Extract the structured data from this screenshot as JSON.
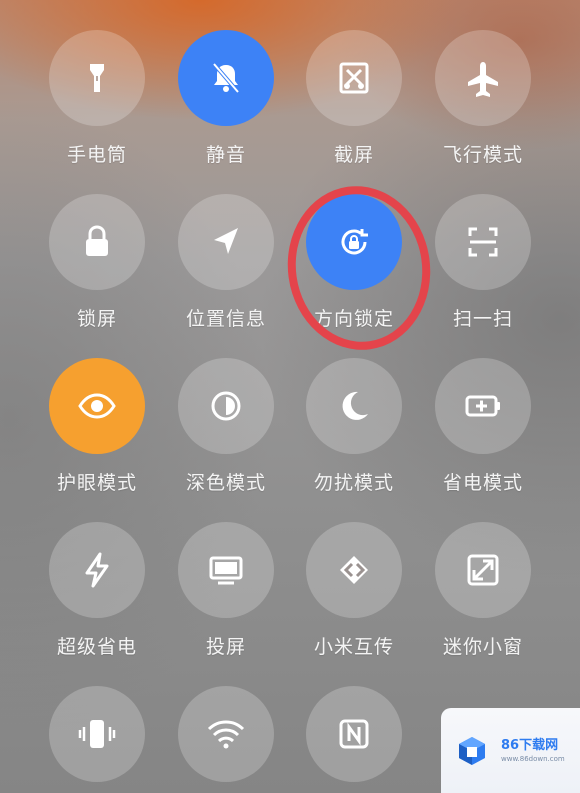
{
  "tiles": [
    {
      "id": "flashlight",
      "label": "手电筒",
      "icon": "flashlight-icon",
      "active": false
    },
    {
      "id": "mute",
      "label": "静音",
      "icon": "mute-bell-icon",
      "active": true,
      "active_color": "#3d82f6"
    },
    {
      "id": "screenshot",
      "label": "截屏",
      "icon": "screenshot-scissors-icon",
      "active": false
    },
    {
      "id": "airplane",
      "label": "飞行模式",
      "icon": "airplane-icon",
      "active": false
    },
    {
      "id": "lock-screen",
      "label": "锁屏",
      "icon": "lock-icon",
      "active": false
    },
    {
      "id": "location",
      "label": "位置信息",
      "icon": "location-arrow-icon",
      "active": false
    },
    {
      "id": "rotation-lock",
      "label": "方向锁定",
      "icon": "rotation-lock-icon",
      "active": true,
      "active_color": "#3d82f6",
      "highlighted": true
    },
    {
      "id": "scan",
      "label": "扫一扫",
      "icon": "scan-icon",
      "active": false
    },
    {
      "id": "eye-care",
      "label": "护眼模式",
      "icon": "eye-icon",
      "active": true,
      "active_color": "#f6a02f"
    },
    {
      "id": "dark-mode",
      "label": "深色模式",
      "icon": "contrast-icon",
      "active": false
    },
    {
      "id": "dnd",
      "label": "勿扰模式",
      "icon": "moon-icon",
      "active": false
    },
    {
      "id": "battery-saver",
      "label": "省电模式",
      "icon": "battery-saver-icon",
      "active": false
    },
    {
      "id": "ultra-saver",
      "label": "超级省电",
      "icon": "lightning-icon",
      "active": false
    },
    {
      "id": "cast",
      "label": "投屏",
      "icon": "monitor-icon",
      "active": false
    },
    {
      "id": "mi-share",
      "label": "小米互传",
      "icon": "mi-share-icon",
      "active": false
    },
    {
      "id": "mini-window",
      "label": "迷你小窗",
      "icon": "mini-window-icon",
      "active": false
    },
    {
      "id": "vibrate",
      "label": "",
      "icon": "vibrate-icon",
      "active": false
    },
    {
      "id": "wifi",
      "label": "",
      "icon": "wifi-icon",
      "active": false
    },
    {
      "id": "nfc",
      "label": "",
      "icon": "nfc-icon",
      "active": false
    }
  ],
  "watermark": {
    "title": "86下载网",
    "subtitle": "www.86down.com",
    "logo_icon": "cube-logo-icon"
  },
  "colors": {
    "accent_blue": "#3d82f6",
    "accent_orange": "#f6a02f",
    "highlight_ring": "#e4444b"
  }
}
